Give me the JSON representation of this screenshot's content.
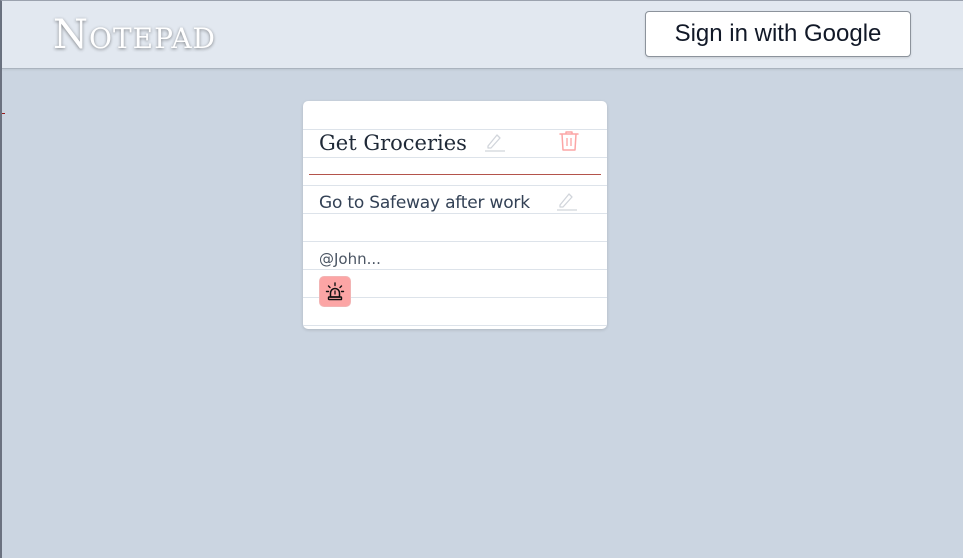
{
  "header": {
    "title": "Notepad",
    "signin_label": "Sign in with Google"
  },
  "note": {
    "title": "Get Groceries",
    "body": "Go to Safeway after work",
    "author": "@John...",
    "edit_title_icon": "pencil-icon",
    "delete_icon": "trash-icon",
    "edit_body_icon": "pencil-icon",
    "alarm_icon": "siren-icon"
  },
  "colors": {
    "page_background": "#cbd5e1",
    "header_background": "#e2e8f0",
    "card_background": "#ffffff",
    "margin_rule": "#b4534b",
    "alarm_button": "#fca5a5",
    "delete_icon": "#fca5a5"
  }
}
